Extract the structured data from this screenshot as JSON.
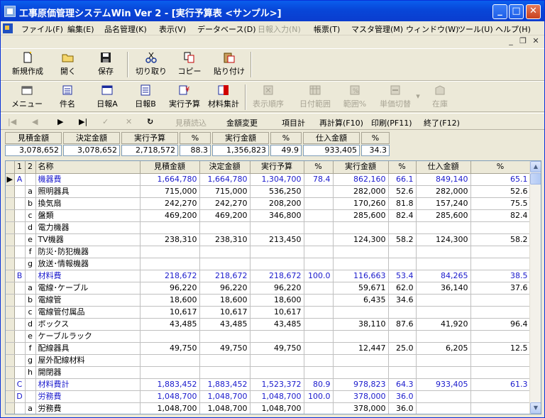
{
  "window": {
    "title": "工事原価管理システムWin Ver 2 - [実行予算表 <サンプル>]"
  },
  "menu": [
    {
      "label": "ファイル(F)",
      "disabled": false
    },
    {
      "label": "編集(E)",
      "disabled": false
    },
    {
      "label": "品名管理(K)",
      "disabled": false
    },
    {
      "label": "表示(V)",
      "disabled": false
    },
    {
      "label": "データベース(D)",
      "disabled": false
    },
    {
      "label": "日報入力(N)",
      "disabled": true
    },
    {
      "label": "帳票(T)",
      "disabled": false
    },
    {
      "label": "マスタ管理(M)",
      "disabled": false
    },
    {
      "label": "ウィンドウ(W)",
      "disabled": false
    },
    {
      "label": "ツール(U)",
      "disabled": false
    },
    {
      "label": "ヘルプ(H)",
      "disabled": false
    }
  ],
  "toolbar1": [
    "新規作成",
    "開く",
    "保存",
    "切り取り",
    "コピー",
    "貼り付け"
  ],
  "toolbar2": [
    {
      "label": "メニュー",
      "disabled": false
    },
    {
      "label": "件名",
      "disabled": false
    },
    {
      "label": "日報A",
      "disabled": false
    },
    {
      "label": "日報B",
      "disabled": false
    },
    {
      "label": "実行予算",
      "disabled": false
    },
    {
      "label": "材料集計",
      "disabled": false
    },
    {
      "label": "表示順序",
      "disabled": true
    },
    {
      "label": "日付範囲",
      "disabled": true
    },
    {
      "label": "範囲%",
      "disabled": true
    },
    {
      "label": "単価切替",
      "disabled": true
    },
    {
      "label": "在庫",
      "disabled": true
    }
  ],
  "toolbar3": {
    "estimate_read": "見積読込",
    "amount_change": "金額変更",
    "item_total": "項目計",
    "recalc": "再計算(F10)",
    "print": "印刷(PF11)",
    "exit": "終了(F12)"
  },
  "summary": {
    "headers": [
      "見積金額",
      "決定金額",
      "実行予算",
      "%",
      "実行金額",
      "%",
      "仕入金額",
      "%"
    ],
    "values": [
      "3,078,652",
      "3,078,652",
      "2,718,572",
      "88.3",
      "1,356,823",
      "49.9",
      "933,405",
      "34.3"
    ]
  },
  "grid": {
    "headers": [
      "1",
      "2",
      "名称",
      "見積金額",
      "決定金額",
      "実行予算",
      "%",
      "実行金額",
      "%",
      "仕入金額",
      "%"
    ],
    "rows": [
      {
        "c1": "A",
        "c2": "",
        "name": "機器費",
        "mitsumori": "1,664,780",
        "kettei": "1,664,780",
        "jikko": "1,304,700",
        "p1": "78.4",
        "jikkokin": "862,160",
        "p2": "66.1",
        "shiire": "849,140",
        "p3": "65.1",
        "blue": true,
        "current": true
      },
      {
        "c1": "",
        "c2": "a",
        "name": "照明器具",
        "mitsumori": "715,000",
        "kettei": "715,000",
        "jikko": "536,250",
        "p1": "",
        "jikkokin": "282,000",
        "p2": "52.6",
        "shiire": "282,000",
        "p3": "52.6"
      },
      {
        "c1": "",
        "c2": "b",
        "name": "換気扇",
        "mitsumori": "242,270",
        "kettei": "242,270",
        "jikko": "208,200",
        "p1": "",
        "jikkokin": "170,260",
        "p2": "81.8",
        "shiire": "157,240",
        "p3": "75.5"
      },
      {
        "c1": "",
        "c2": "c",
        "name": "盤類",
        "mitsumori": "469,200",
        "kettei": "469,200",
        "jikko": "346,800",
        "p1": "",
        "jikkokin": "285,600",
        "p2": "82.4",
        "shiire": "285,600",
        "p3": "82.4"
      },
      {
        "c1": "",
        "c2": "d",
        "name": "電力機器",
        "mitsumori": "",
        "kettei": "",
        "jikko": "",
        "p1": "",
        "jikkokin": "",
        "p2": "",
        "shiire": "",
        "p3": ""
      },
      {
        "c1": "",
        "c2": "e",
        "name": "TV機器",
        "mitsumori": "238,310",
        "kettei": "238,310",
        "jikko": "213,450",
        "p1": "",
        "jikkokin": "124,300",
        "p2": "58.2",
        "shiire": "124,300",
        "p3": "58.2"
      },
      {
        "c1": "",
        "c2": "f",
        "name": "防災･防犯機器",
        "mitsumori": "",
        "kettei": "",
        "jikko": "",
        "p1": "",
        "jikkokin": "",
        "p2": "",
        "shiire": "",
        "p3": ""
      },
      {
        "c1": "",
        "c2": "g",
        "name": "放送･情報機器",
        "mitsumori": "",
        "kettei": "",
        "jikko": "",
        "p1": "",
        "jikkokin": "",
        "p2": "",
        "shiire": "",
        "p3": ""
      },
      {
        "c1": "B",
        "c2": "",
        "name": "材料費",
        "mitsumori": "218,672",
        "kettei": "218,672",
        "jikko": "218,672",
        "p1": "100.0",
        "jikkokin": "116,663",
        "p2": "53.4",
        "shiire": "84,265",
        "p3": "38.5",
        "blue": true
      },
      {
        "c1": "",
        "c2": "a",
        "name": "電線･ケーブル",
        "mitsumori": "96,220",
        "kettei": "96,220",
        "jikko": "96,220",
        "p1": "",
        "jikkokin": "59,671",
        "p2": "62.0",
        "shiire": "36,140",
        "p3": "37.6"
      },
      {
        "c1": "",
        "c2": "b",
        "name": "電線管",
        "mitsumori": "18,600",
        "kettei": "18,600",
        "jikko": "18,600",
        "p1": "",
        "jikkokin": "6,435",
        "p2": "34.6",
        "shiire": "",
        "p3": ""
      },
      {
        "c1": "",
        "c2": "c",
        "name": "電線管付属品",
        "mitsumori": "10,617",
        "kettei": "10,617",
        "jikko": "10,617",
        "p1": "",
        "jikkokin": "",
        "p2": "",
        "shiire": "",
        "p3": ""
      },
      {
        "c1": "",
        "c2": "d",
        "name": "ボックス",
        "mitsumori": "43,485",
        "kettei": "43,485",
        "jikko": "43,485",
        "p1": "",
        "jikkokin": "38,110",
        "p2": "87.6",
        "shiire": "41,920",
        "p3": "96.4"
      },
      {
        "c1": "",
        "c2": "e",
        "name": "ケーブルラック",
        "mitsumori": "",
        "kettei": "",
        "jikko": "",
        "p1": "",
        "jikkokin": "",
        "p2": "",
        "shiire": "",
        "p3": ""
      },
      {
        "c1": "",
        "c2": "f",
        "name": "配線器具",
        "mitsumori": "49,750",
        "kettei": "49,750",
        "jikko": "49,750",
        "p1": "",
        "jikkokin": "12,447",
        "p2": "25.0",
        "shiire": "6,205",
        "p3": "12.5"
      },
      {
        "c1": "",
        "c2": "g",
        "name": "屋外配線材料",
        "mitsumori": "",
        "kettei": "",
        "jikko": "",
        "p1": "",
        "jikkokin": "",
        "p2": "",
        "shiire": "",
        "p3": ""
      },
      {
        "c1": "",
        "c2": "h",
        "name": "開閉器",
        "mitsumori": "",
        "kettei": "",
        "jikko": "",
        "p1": "",
        "jikkokin": "",
        "p2": "",
        "shiire": "",
        "p3": ""
      },
      {
        "c1": "C",
        "c2": "",
        "name": "材料費計",
        "mitsumori": "1,883,452",
        "kettei": "1,883,452",
        "jikko": "1,523,372",
        "p1": "80.9",
        "jikkokin": "978,823",
        "p2": "64.3",
        "shiire": "933,405",
        "p3": "61.3",
        "blue": true
      },
      {
        "c1": "D",
        "c2": "",
        "name": "労務費",
        "mitsumori": "1,048,700",
        "kettei": "1,048,700",
        "jikko": "1,048,700",
        "p1": "100.0",
        "jikkokin": "378,000",
        "p2": "36.0",
        "shiire": "",
        "p3": "",
        "blue": true
      },
      {
        "c1": "",
        "c2": "a",
        "name": "労務費",
        "mitsumori": "1,048,700",
        "kettei": "1,048,700",
        "jikko": "1,048,700",
        "p1": "",
        "jikkokin": "378,000",
        "p2": "36.0",
        "shiire": "",
        "p3": ""
      }
    ]
  },
  "icons": {
    "new": "new-file-icon",
    "open": "open-folder-icon",
    "save": "save-disk-icon",
    "cut": "scissors-icon",
    "copy": "copy-icon",
    "paste": "paste-icon"
  }
}
